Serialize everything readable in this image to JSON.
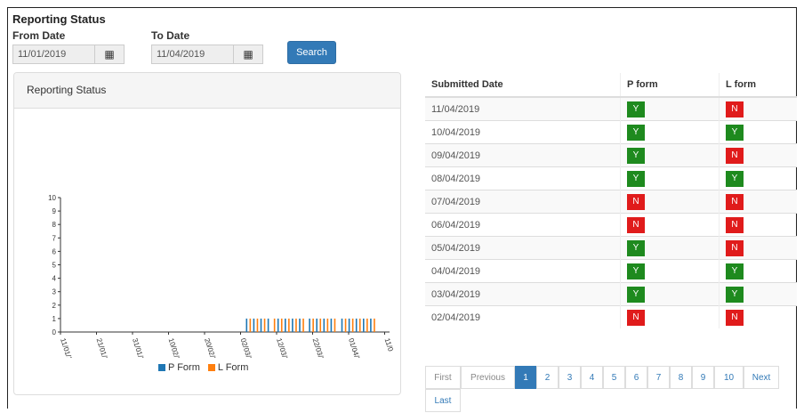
{
  "page_title": "Reporting Status",
  "filters": {
    "from_label": "From Date",
    "from_value": "11/01/2019",
    "to_label": "To Date",
    "to_value": "11/04/2019",
    "search_label": "Search"
  },
  "panel": {
    "title": "Reporting Status"
  },
  "chart_data": {
    "type": "bar",
    "ylim": [
      0,
      10
    ],
    "yticks": [
      "0",
      "1",
      "2",
      "3",
      "4",
      "5",
      "6",
      "7",
      "8",
      "9",
      "10"
    ],
    "xticks": [
      "11/01/2019",
      "21/01/2019",
      "31/01/2019",
      "10/02/2019",
      "20/02/2019",
      "02/03/2019",
      "12/03/2019",
      "22/03/2019",
      "01/04/2019",
      "11/0"
    ],
    "series": [
      {
        "name": "P Form",
        "color": "#1f77b4"
      },
      {
        "name": "L Form",
        "color": "#ff7f0e"
      }
    ],
    "bars": [
      [
        0,
        1
      ],
      [
        1,
        1
      ],
      [
        0,
        1
      ],
      [
        1,
        1
      ],
      [
        0,
        1
      ],
      [
        1,
        1
      ],
      [
        0,
        1
      ],
      [
        1,
        1
      ],
      [
        0,
        1
      ],
      [
        1,
        1
      ],
      [
        0,
        1
      ],
      [
        1,
        1
      ],
      [
        0,
        1
      ],
      [
        1,
        1
      ],
      [
        0,
        1
      ],
      [
        1,
        1
      ],
      [
        0,
        1
      ],
      [
        1,
        1
      ],
      [
        0,
        1
      ],
      [
        1,
        1
      ],
      [
        0,
        1
      ],
      [
        1,
        1
      ],
      [
        0,
        1
      ],
      [
        1,
        1
      ],
      [
        0,
        1
      ],
      [
        1,
        1
      ],
      [
        0,
        1
      ],
      [
        1,
        1
      ],
      [
        0,
        1
      ],
      [
        1,
        1
      ],
      [
        0,
        1
      ],
      [
        1,
        1
      ],
      [
        0,
        1
      ],
      [
        1,
        1
      ]
    ],
    "legend_position": "bottom"
  },
  "table": {
    "headers": [
      "Submitted Date",
      "P form",
      "L form"
    ],
    "rows": [
      {
        "date": "11/04/2019",
        "p": "Y",
        "l": "N"
      },
      {
        "date": "10/04/2019",
        "p": "Y",
        "l": "Y"
      },
      {
        "date": "09/04/2019",
        "p": "Y",
        "l": "N"
      },
      {
        "date": "08/04/2019",
        "p": "Y",
        "l": "Y"
      },
      {
        "date": "07/04/2019",
        "p": "N",
        "l": "N"
      },
      {
        "date": "06/04/2019",
        "p": "N",
        "l": "N"
      },
      {
        "date": "05/04/2019",
        "p": "Y",
        "l": "N"
      },
      {
        "date": "04/04/2019",
        "p": "Y",
        "l": "Y"
      },
      {
        "date": "03/04/2019",
        "p": "Y",
        "l": "Y"
      },
      {
        "date": "02/04/2019",
        "p": "N",
        "l": "N"
      }
    ]
  },
  "pagination": {
    "first": "First",
    "previous": "Previous",
    "pages": [
      "1",
      "2",
      "3",
      "4",
      "5",
      "6",
      "7",
      "8",
      "9",
      "10"
    ],
    "active": "1",
    "next": "Next",
    "last": "Last"
  },
  "icons": {
    "calendar": "calendar-icon"
  },
  "colors": {
    "yes": "#1e8a1e",
    "no": "#e01b1b",
    "primary": "#337ab7"
  }
}
